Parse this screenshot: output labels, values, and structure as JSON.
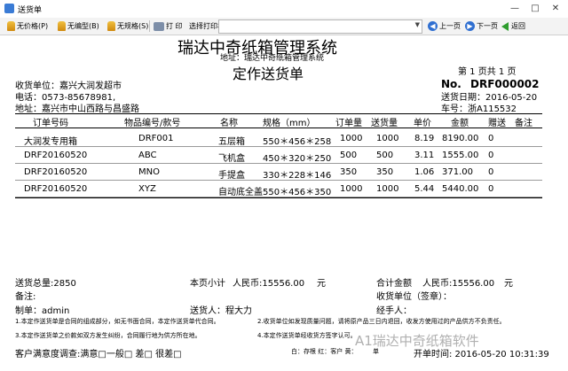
{
  "window": {
    "title": "送货单",
    "controls": {
      "minimize": "—",
      "maximize": "□",
      "close": "✕"
    }
  },
  "toolbar": {
    "no_price": "无价格(P)",
    "no_model": "无编型(B)",
    "no_spec": "无规格(S)",
    "print": "打 印",
    "choose_printer": "选择打印机：",
    "printer_value": "",
    "prev": "上一页",
    "next": "下一页",
    "back": "返回"
  },
  "document": {
    "company": "瑞达中奇纸箱管理系统",
    "company_address": "地址：瑞达中奇纸箱管理系统",
    "title": "定作送货单",
    "page_info": "第 1 页共 1 页",
    "no_label": "No.",
    "no_value": "DRF000002",
    "delivery_date": "送货日期：2016-05-20",
    "vehicle": "车号：浙A115532",
    "receiver": "收货单位：嘉兴大润发超市",
    "phone": "电话：0573-85678981,",
    "address": "地址：嘉兴市中山西路与昌盛路",
    "columns": [
      "订单号码",
      "物品编号/款号",
      "名称",
      "规格（mm）",
      "订单量",
      "送货量",
      "单价",
      "金额",
      "赠送",
      "备注"
    ],
    "rows": [
      [
        "大润发专用箱",
        "DRF001",
        "五层箱",
        "550＊456＊258",
        "1000",
        "1000",
        "8.19",
        "8190.00",
        "0",
        ""
      ],
      [
        "DRF20160520",
        "ABC",
        "飞机盒",
        "450＊320＊250",
        "500",
        "500",
        "3.11",
        "1555.00",
        "0",
        ""
      ],
      [
        "DRF20160520",
        "MNO",
        "手提盒",
        "330＊228＊146",
        "350",
        "350",
        "1.06",
        "371.00",
        "0",
        ""
      ],
      [
        "DRF20160520",
        "XYZ",
        "自动底全盖",
        "550＊456＊350",
        "1000",
        "1000",
        "5.44",
        "5440.00",
        "0",
        ""
      ]
    ],
    "total_qty": "送货总量:2850",
    "page_subtotal": "本页小计",
    "page_subtotal_amount": "人民币:15556.00",
    "page_subtotal_unit": "元",
    "total_amount": "合计金额",
    "total_amount_value": "人民币:15556.00",
    "total_amount_unit": "元",
    "remark": "备注:",
    "receiver_sign": "收货单位（签章）：",
    "maker": "制单：admin",
    "deliverer": "送货人：程大力",
    "handler": "经手人：",
    "note1": "1.本定作送货单是合同的组成部分，如无书面合同，本定作送货单代合同。",
    "note2": "2.收货单位如发现质量问题，请将原产品三日内退回，收发方使用过的产品供方不负责任。",
    "note3": "3.本定作送货单之价款如双方发生纠纷，合同履行地为供方所在地。",
    "note4": "4.本定作送货单经收货方签字认可。",
    "satisfaction": "客户满意度调查:满意□一般□  差□  很差□",
    "copies": "白：存根  红：客户  黄：",
    "copies_tail": "单",
    "print_time": "开单时间: 2016-05-20 10:31:39",
    "watermark": "A1瑞达中奇纸箱软件"
  }
}
